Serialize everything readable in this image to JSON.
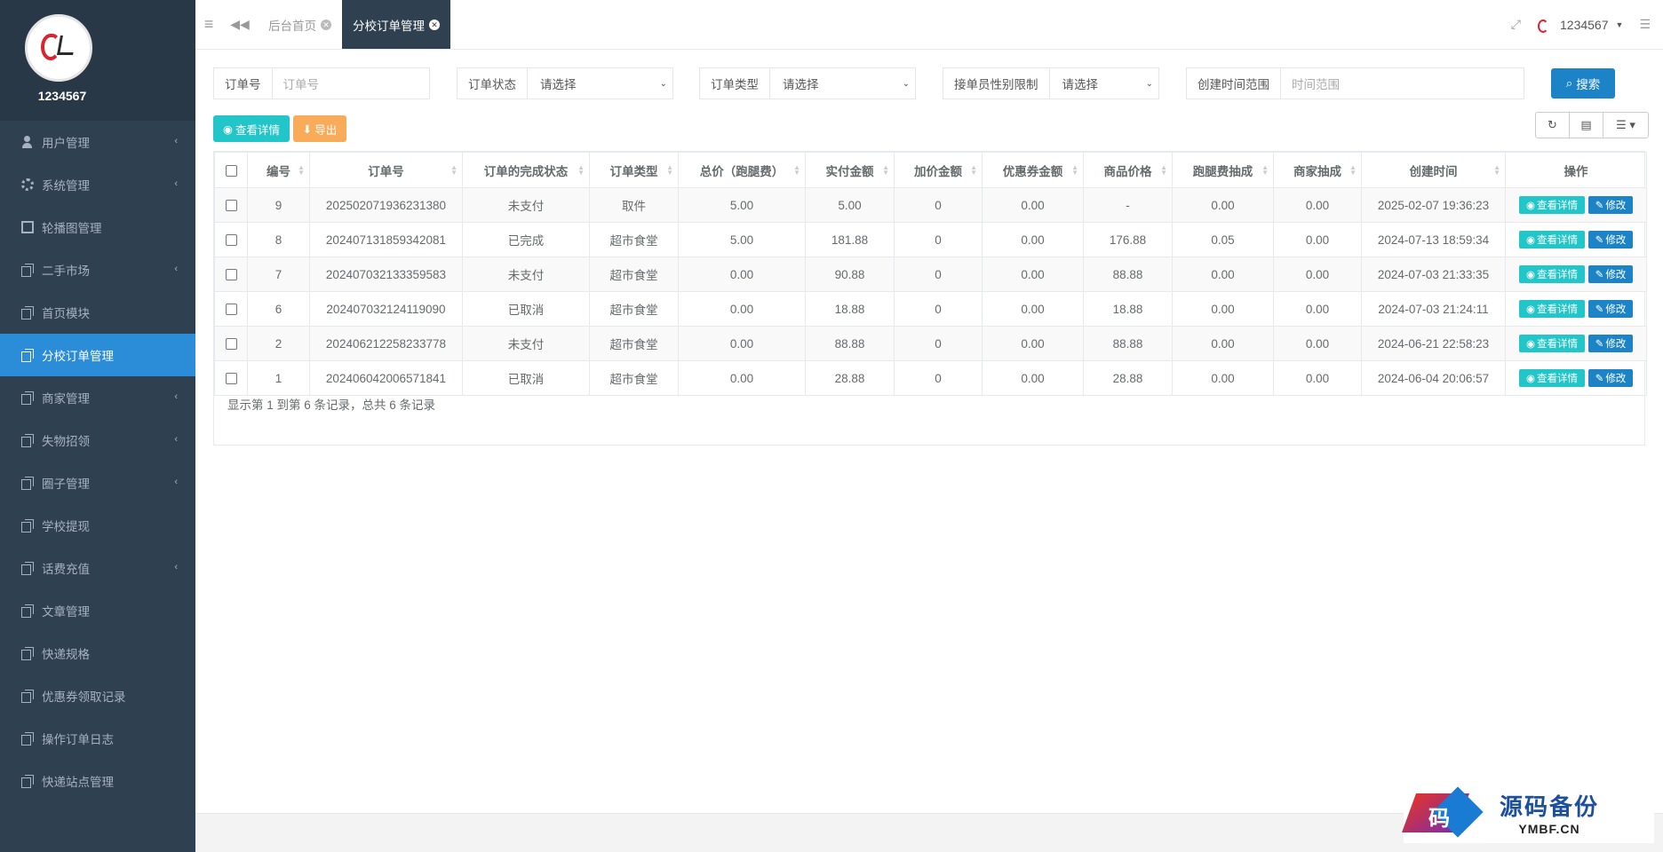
{
  "profile": {
    "name": "1234567"
  },
  "sidebar": {
    "items": [
      {
        "label": "用户管理",
        "icon": "user-icon",
        "has_arrow": true
      },
      {
        "label": "系统管理",
        "icon": "gear-icon",
        "has_arrow": true
      },
      {
        "label": "轮播图管理",
        "icon": "monitor-icon",
        "has_arrow": false
      },
      {
        "label": "二手市场",
        "icon": "copy-icon",
        "has_arrow": true
      },
      {
        "label": "首页模块",
        "icon": "copy-icon",
        "has_arrow": false
      },
      {
        "label": "分校订单管理",
        "icon": "copy-icon",
        "has_arrow": false,
        "active": true
      },
      {
        "label": "商家管理",
        "icon": "copy-icon",
        "has_arrow": true
      },
      {
        "label": "失物招领",
        "icon": "copy-icon",
        "has_arrow": true
      },
      {
        "label": "圈子管理",
        "icon": "copy-icon",
        "has_arrow": true
      },
      {
        "label": "学校提现",
        "icon": "copy-icon",
        "has_arrow": false
      },
      {
        "label": "话费充值",
        "icon": "copy-icon",
        "has_arrow": true
      },
      {
        "label": "文章管理",
        "icon": "copy-icon",
        "has_arrow": false
      },
      {
        "label": "快递规格",
        "icon": "copy-icon",
        "has_arrow": false
      },
      {
        "label": "优惠券领取记录",
        "icon": "copy-icon",
        "has_arrow": false
      },
      {
        "label": "操作订单日志",
        "icon": "copy-icon",
        "has_arrow": false
      },
      {
        "label": "快递站点管理",
        "icon": "copy-icon",
        "has_arrow": false
      }
    ]
  },
  "topbar": {
    "tabs": [
      {
        "label": "后台首页",
        "active": false
      },
      {
        "label": "分校订单管理",
        "active": true
      }
    ],
    "user": "1234567"
  },
  "search": {
    "order_no": {
      "label": "订单号",
      "placeholder": "订单号"
    },
    "order_status": {
      "label": "订单状态",
      "value": "请选择"
    },
    "order_type": {
      "label": "订单类型",
      "value": "请选择"
    },
    "gender_limit": {
      "label": "接单员性别限制",
      "value": "请选择"
    },
    "time_range": {
      "label": "创建时间范围",
      "placeholder": "时间范围"
    },
    "search_button": "搜索"
  },
  "toolbar": {
    "detail_button": "查看详情",
    "export_button": "导出"
  },
  "table": {
    "headers": [
      "编号",
      "订单号",
      "订单的完成状态",
      "订单类型",
      "总价（跑腿费）",
      "实付金额",
      "加价金额",
      "优惠券金额",
      "商品价格",
      "跑腿费抽成",
      "商家抽成",
      "创建时间",
      "操作"
    ],
    "rows": [
      [
        "9",
        "202502071936231380",
        "未支付",
        "取件",
        "5.00",
        "5.00",
        "0",
        "0.00",
        "-",
        "0.00",
        "0.00",
        "2025-02-07 19:36:23"
      ],
      [
        "8",
        "202407131859342081",
        "已完成",
        "超市食堂",
        "5.00",
        "181.88",
        "0",
        "0.00",
        "176.88",
        "0.05",
        "0.00",
        "2024-07-13 18:59:34"
      ],
      [
        "7",
        "202407032133359583",
        "未支付",
        "超市食堂",
        "0.00",
        "90.88",
        "0",
        "0.00",
        "88.88",
        "0.00",
        "0.00",
        "2024-07-03 21:33:35"
      ],
      [
        "6",
        "202407032124119090",
        "已取消",
        "超市食堂",
        "0.00",
        "18.88",
        "0",
        "0.00",
        "18.88",
        "0.00",
        "0.00",
        "2024-07-03 21:24:11"
      ],
      [
        "2",
        "202406212258233778",
        "未支付",
        "超市食堂",
        "0.00",
        "88.88",
        "0",
        "0.00",
        "88.88",
        "0.00",
        "0.00",
        "2024-06-21 22:58:23"
      ],
      [
        "1",
        "202406042006571841",
        "已取消",
        "超市食堂",
        "0.00",
        "28.88",
        "0",
        "0.00",
        "28.88",
        "0.00",
        "0.00",
        "2024-06-04 20:06:57"
      ]
    ],
    "row_actions": {
      "detail": "查看详情",
      "edit": "修改"
    },
    "summary": "显示第 1 到第 6 条记录，总共 6 条记录"
  },
  "watermark": {
    "cn": "源码备份",
    "en": "YMBF.CN",
    "logo_char": "码"
  },
  "colors": {
    "sidebar": "#2f4050",
    "active": "#2b8cd8",
    "info": "#23c6c8",
    "warning": "#f8ac59",
    "primary": "#1c84c6"
  }
}
